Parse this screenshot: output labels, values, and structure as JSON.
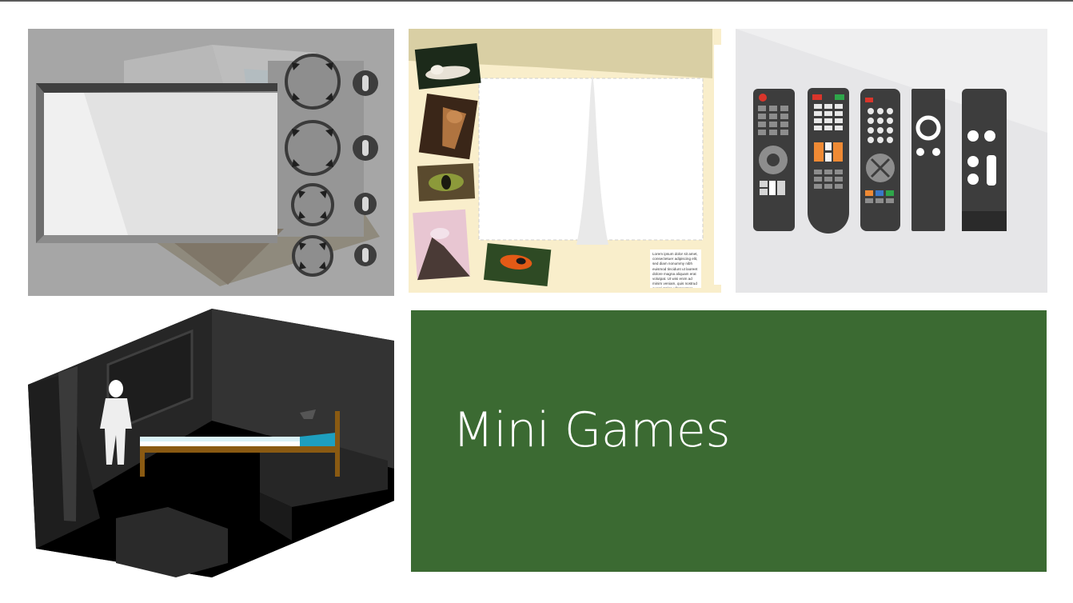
{
  "section": {
    "title": "Mini Games",
    "accent_color": "#3b6a32"
  },
  "tiles": [
    {
      "id": "tv-controls-game",
      "icons": [
        "tv-screen-icon",
        "dial-icon",
        "switch-icon"
      ]
    },
    {
      "id": "photo-layout-game",
      "icons": [
        "tiger-photo",
        "deer-photo",
        "eye-photo",
        "mountain-photo",
        "frog-photo"
      ],
      "caption_text": "Lorem ipsum dolor sit amet, consectetuer adipiscing elit, sed diam nonummy nibh euismod tincidunt ut laoreet dolore magna aliquam erat volutpat. Ut wisi enim ad minim veniam, quis nostrud exerci tation ullamcorper suscipit lobortis nisl ut aliquip ex ea commodo consequat."
    },
    {
      "id": "remote-controls-game",
      "icons": [
        "remote-control-icon"
      ]
    },
    {
      "id": "dark-bedroom-game",
      "icons": [
        "person-figure",
        "bed-icon",
        "window-icon"
      ]
    }
  ],
  "colors": {
    "tv_bg": "#a6a6a6",
    "photo_bg": "#f9eecb",
    "remote_bg": "#e6e6e8",
    "room_dark": "#1a1a1a",
    "bed_frame": "#8a5a12",
    "bed_sheet": "#1e9fbf"
  }
}
